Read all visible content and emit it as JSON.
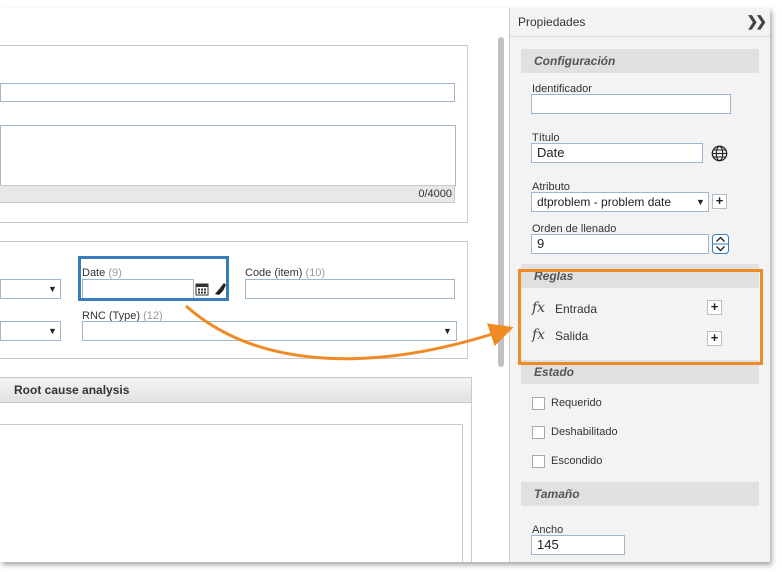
{
  "form": {
    "description_counter": "0/4000",
    "date_field": {
      "label": "Date",
      "number": "(9)"
    },
    "code_field": {
      "label": "Code (item)",
      "number": "(10)"
    },
    "rnc_field": {
      "label": "RNC (Type)",
      "number": "(12)"
    },
    "section_tab": "Root cause analysis"
  },
  "panel": {
    "title": "Propiedades",
    "collapse_icon": "double-chevron-right-icon",
    "configuracion": {
      "heading": "Configuración",
      "identificador_label": "Identificador",
      "identificador_value": "",
      "titulo_label": "Título",
      "titulo_value": "Date",
      "atributo_label": "Atributo",
      "atributo_value": "dtproblem - problem date",
      "orden_label": "Orden de llenado",
      "orden_value": "9"
    },
    "reglas": {
      "heading": "Reglas",
      "entrada": "Entrada",
      "salida": "Salida",
      "fx_symbol": "fx"
    },
    "estado": {
      "heading": "Estado",
      "requerido": "Requerido",
      "deshabilitado": "Deshabilitado",
      "escondido": "Escondido"
    },
    "tamano": {
      "heading": "Tamaño",
      "ancho_label": "Ancho",
      "ancho_value": "145"
    }
  },
  "colors": {
    "highlight_blue": "#3a7bbf",
    "highlight_orange": "#f08a24"
  }
}
